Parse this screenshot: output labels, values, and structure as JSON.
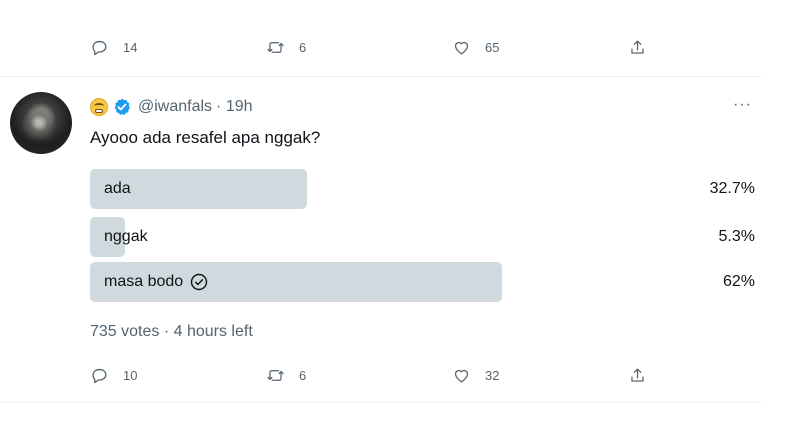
{
  "previous_tweet": {
    "actions": {
      "reply_count": "14",
      "retweet_count": "6",
      "like_count": "65"
    }
  },
  "tweet": {
    "handle": "@iwanfals",
    "time": "· 19h",
    "more_label": "···",
    "text": "Ayooo ada resafel apa nggak?",
    "poll": {
      "options": [
        {
          "label": "ada",
          "percent_text": "32.7%",
          "percent": 32.7,
          "selected": false
        },
        {
          "label": "nggak",
          "percent_text": "5.3%",
          "percent": 5.3,
          "selected": false
        },
        {
          "label": "masa bodo",
          "percent_text": "62%",
          "percent": 62,
          "selected": true
        }
      ],
      "summary": "735 votes · 4 hours left"
    },
    "actions": {
      "reply_count": "10",
      "retweet_count": "6",
      "like_count": "32"
    }
  },
  "colors": {
    "bar": "#cfd9de",
    "verified": "#1d9bf0",
    "muted_text": "#536471"
  },
  "icons": [
    "reply-icon",
    "retweet-icon",
    "like-icon",
    "share-icon",
    "verified-badge-icon",
    "grinning-emoji-icon",
    "check-circle-icon"
  ]
}
